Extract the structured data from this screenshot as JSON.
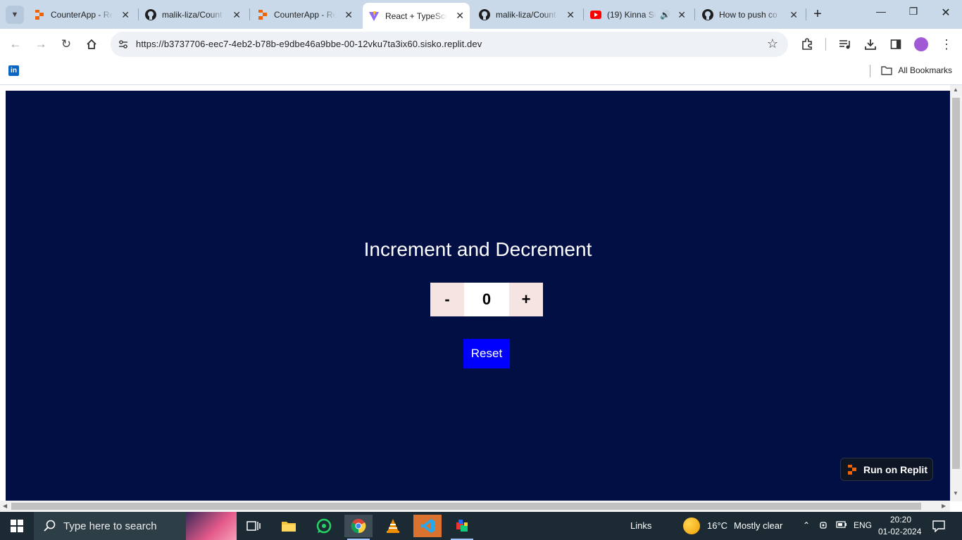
{
  "browser": {
    "tabs": [
      {
        "title": "CounterApp - Re",
        "favicon": "replit-icon",
        "active": false
      },
      {
        "title": "malik-liza/Count",
        "favicon": "github-icon",
        "active": false
      },
      {
        "title": "CounterApp - Re",
        "favicon": "replit-icon",
        "active": false
      },
      {
        "title": "React + TypeScri",
        "favicon": "vite-icon",
        "active": true
      },
      {
        "title": "malik-liza/Count",
        "favicon": "github-icon",
        "active": false
      },
      {
        "title": "(19) Kinna Su",
        "favicon": "youtube-icon",
        "active": false
      },
      {
        "title": "How to push co",
        "favicon": "github-icon",
        "active": false
      }
    ],
    "url": "https://b3737706-eec7-4eb2-b78b-e9dbe46a9bbe-00-12vku7ta3ix60.sisko.replit.dev",
    "bookmarks": {
      "all_label": "All Bookmarks"
    }
  },
  "app": {
    "heading": "Increment and Decrement",
    "decrement_label": "-",
    "count": "0",
    "increment_label": "+",
    "reset_label": "Reset",
    "run_on_replit_label": "Run on Replit",
    "colors": {
      "background": "#020f44",
      "reset": "#0000ff",
      "counter_btn": "#f6e4e2"
    }
  },
  "taskbar": {
    "search_placeholder": "Type here to search",
    "links_label": "Links",
    "weather": {
      "temp": "16°C",
      "condition": "Mostly clear"
    },
    "language": "ENG",
    "time": "20:20",
    "date": "01-02-2024"
  }
}
